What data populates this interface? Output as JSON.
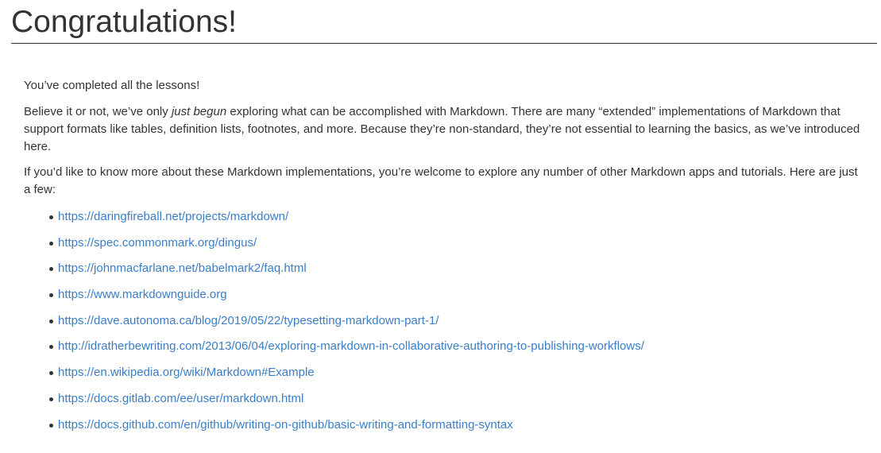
{
  "heading": "Congratulations!",
  "intro": "You’ve completed all the lessons!",
  "para2": {
    "before": "Believe it or not, we’ve only ",
    "emphasis": "just begun",
    "after": " exploring what can be accomplished with Markdown. There are many “extended” implementations of Markdown that support formats like tables, definition lists, footnotes, and more. Because they’re non-standard, they’re not essential to learning the basics, as we’ve introduced here."
  },
  "para3": "If you’d like to know more about these Markdown implementations, you’re welcome to explore any number of other Markdown apps and tutorials. Here are just a few:",
  "links": [
    "https://daringfireball.net/projects/markdown/",
    "https://spec.commonmark.org/dingus/",
    "https://johnmacfarlane.net/babelmark2/faq.html",
    "https://www.markdownguide.org",
    "https://dave.autonoma.ca/blog/2019/05/22/typesetting-markdown-part-1/",
    "http://idratherbewriting.com/2013/06/04/exploring-markdown-in-collaborative-authoring-to-publishing-workflows/",
    "https://en.wikipedia.org/wiki/Markdown#Example",
    "https://docs.gitlab.com/ee/user/markdown.html",
    "https://docs.github.com/en/github/writing-on-github/basic-writing-and-formatting-syntax"
  ],
  "colors": {
    "text": "#333333",
    "link": "#3b7ec6",
    "background": "#ffffff"
  }
}
